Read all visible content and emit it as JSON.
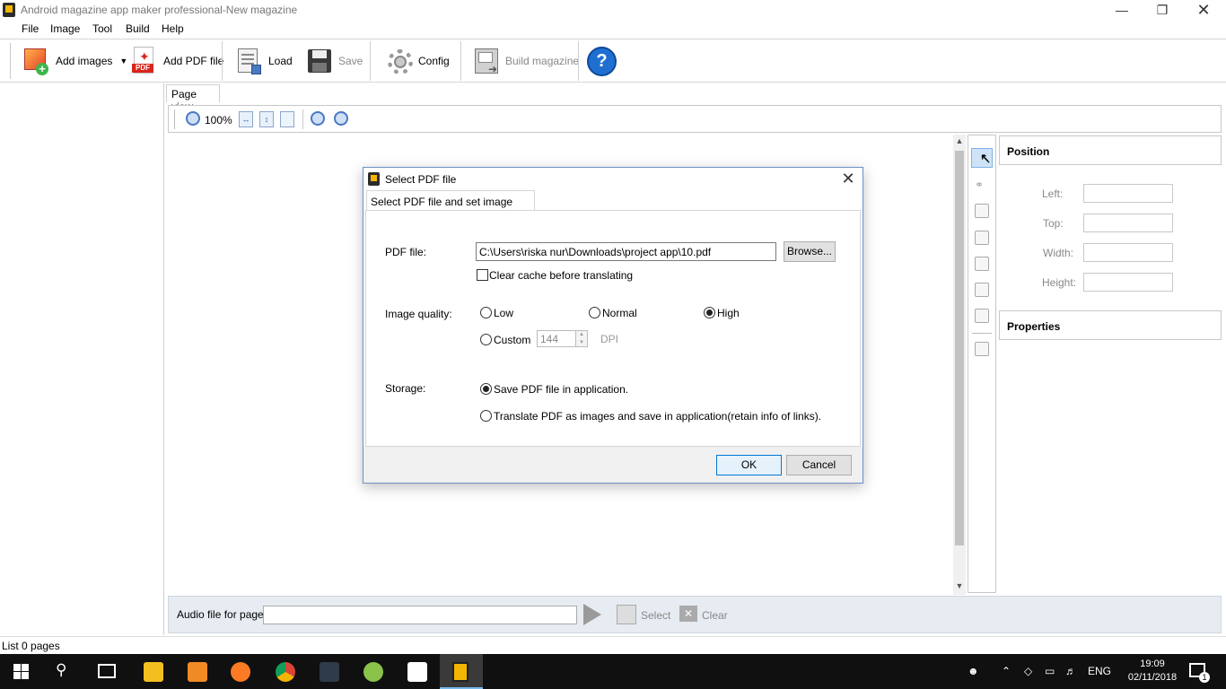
{
  "window": {
    "title": "Android magazine app maker professional-New magazine"
  },
  "menu": [
    "File",
    "Image",
    "Tool",
    "Build",
    "Help"
  ],
  "toolbar": {
    "add_images": "Add images",
    "add_pdf": "Add PDF file",
    "load": "Load",
    "save": "Save",
    "config": "Config",
    "build": "Build magazine",
    "pdf_badge": "PDF"
  },
  "page_view": {
    "tab": "Page view",
    "zoom": "100%"
  },
  "right_panel": {
    "position_title": "Position",
    "left": "Left:",
    "top": "Top:",
    "width": "Width:",
    "height": "Height:",
    "properties_title": "Properties"
  },
  "audio": {
    "label": "Audio file for page:",
    "select": "Select",
    "clear": "Clear"
  },
  "status": "List 0 pages",
  "dialog": {
    "title": "Select PDF file",
    "tab": "Select PDF file and set image quality",
    "pdf_file_label": "PDF file:",
    "pdf_path": "C:\\Users\\riska nur\\Downloads\\project app\\10.pdf",
    "browse": "Browse...",
    "clear_cache": "Clear cache before translating",
    "image_quality_label": "Image quality:",
    "quality_low": "Low",
    "quality_normal": "Normal",
    "quality_high": "High",
    "quality_custom": "Custom",
    "dpi_value": "144",
    "dpi_unit": "DPI",
    "storage_label": "Storage:",
    "storage_save": "Save PDF file in application.",
    "storage_translate": "Translate PDF as images and save in application(retain info of links).",
    "ok": "OK",
    "cancel": "Cancel"
  },
  "taskbar": {
    "lang": "ENG",
    "time": "19:09",
    "date": "02/11/2018",
    "notifications": "1"
  }
}
